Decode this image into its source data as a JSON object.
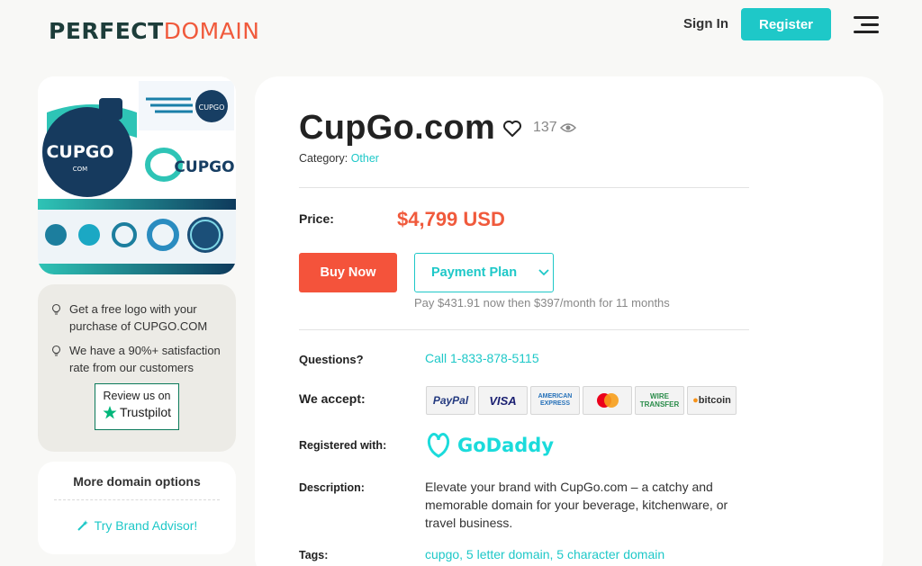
{
  "header": {
    "logo_part1": "PERFECT",
    "logo_part2": "DOMAIN",
    "signin_label": "Sign In",
    "register_label": "Register",
    "menu_icon": "hamburger-icon"
  },
  "sidebar": {
    "logo_image": {
      "main_text": "CUPGO",
      "sub_text": "COM",
      "alt_text": "CUPGO"
    },
    "promo": [
      {
        "icon": "lightbulb-icon",
        "text": "Get a free logo with your purchase of CUPGO.COM"
      },
      {
        "icon": "lightbulb-icon",
        "text": "We have a 90%+ satisfaction rate from our customers"
      }
    ],
    "trustpilot": {
      "line1": "Review us on",
      "line2": "Trustpilot"
    },
    "more": {
      "title": "More domain options",
      "link": "Try Brand Advisor!",
      "link_icon": "magic-wand-icon"
    }
  },
  "domain": {
    "name": "CupGo.com",
    "views": "137",
    "category_label": "Category:",
    "category_value": "Other"
  },
  "pricing": {
    "price_label": "Price:",
    "price": "$4,799 USD",
    "buy_label": "Buy Now",
    "plan_label": "Payment Plan",
    "plan_note": "Pay $431.91 now then $397/month for 11 months"
  },
  "details": {
    "questions_label": "Questions?",
    "questions_value": "Call 1-833-878-5115",
    "accept_label": "We accept:",
    "payment_methods": [
      "PayPal",
      "VISA",
      "AMERICAN EXPRESS",
      "Mastercard",
      "WIRE TRANSFER",
      "bitcoin"
    ],
    "registered_label": "Registered with:",
    "registrar": "GoDaddy",
    "description_label": "Description:",
    "description": "Elevate your brand with CupGo.com – a catchy and memorable domain for your beverage, kitchenware, or travel business.",
    "tags_label": "Tags:",
    "tags": "cupgo, 5 letter domain, 5 character domain"
  },
  "colors": {
    "accent": "#1ec8c8",
    "brand_orange": "#f05a3c",
    "buy": "#f4533b"
  }
}
